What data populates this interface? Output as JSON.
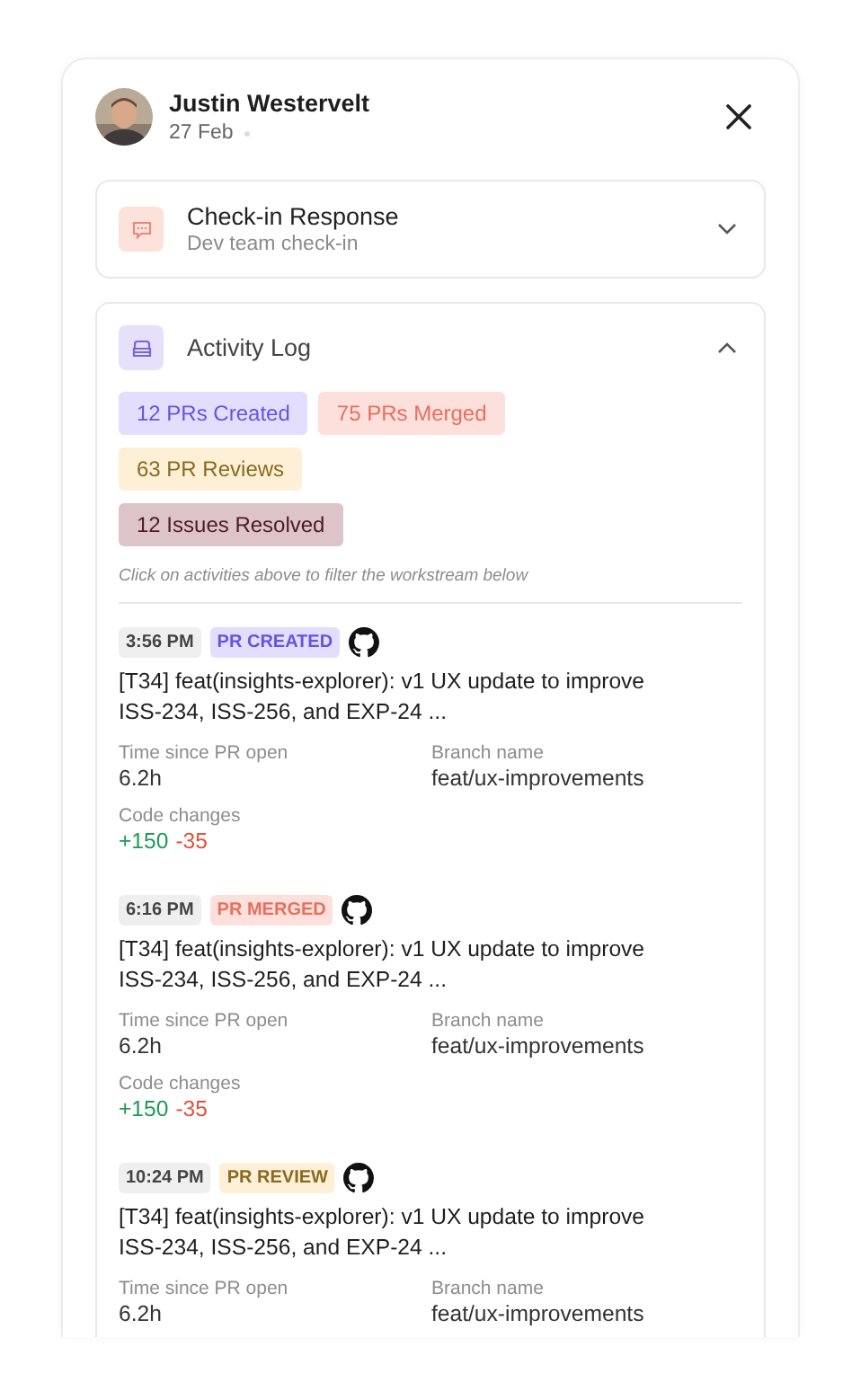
{
  "header": {
    "name": "Justin Westervelt",
    "date": "27 Feb"
  },
  "sections": [
    {
      "title": "Check-in Response",
      "subtitle": "Dev team check-in",
      "kind": "checkin",
      "expanded": false
    },
    {
      "title": "Activity Log",
      "kind": "activity",
      "expanded": true
    }
  ],
  "filters": [
    {
      "label": "12 PRs Created",
      "kind": "created"
    },
    {
      "label": "75 PRs Merged",
      "kind": "merged"
    },
    {
      "label": "63 PR Reviews",
      "kind": "review"
    },
    {
      "label": "12 Issues Resolved",
      "kind": "issue"
    }
  ],
  "hint": "Click on activities above to filter the workstream below",
  "events": [
    {
      "time": "3:56 PM",
      "tag": "PR CREATED",
      "kind": "created",
      "title": "[T34] feat(insights-explorer): v1 UX update to improve ISS-234, ISS-256, and EXP-24 ...",
      "fields": [
        {
          "label": "Time since PR open",
          "value": "6.2h"
        },
        {
          "label": "Branch name",
          "value": "feat/ux-improvements"
        }
      ],
      "code_changes": {
        "label": "Code changes",
        "added": "+150",
        "removed": "-35"
      }
    },
    {
      "time": "6:16 PM",
      "tag": "PR MERGED",
      "kind": "merged",
      "title": "[T34] feat(insights-explorer): v1 UX update to improve ISS-234, ISS-256, and EXP-24 ...",
      "fields": [
        {
          "label": "Time since PR open",
          "value": "6.2h"
        },
        {
          "label": "Branch name",
          "value": "feat/ux-improvements"
        }
      ],
      "code_changes": {
        "label": "Code changes",
        "added": "+150",
        "removed": "-35"
      }
    },
    {
      "time": "10:24 PM",
      "tag": "PR REVIEW",
      "kind": "review",
      "title": "[T34] feat(insights-explorer): v1 UX update to improve ISS-234, ISS-256, and EXP-24 ...",
      "fields": [
        {
          "label": "Time since PR open",
          "value": "6.2h"
        },
        {
          "label": "Branch name",
          "value": "feat/ux-improvements"
        }
      ]
    }
  ]
}
